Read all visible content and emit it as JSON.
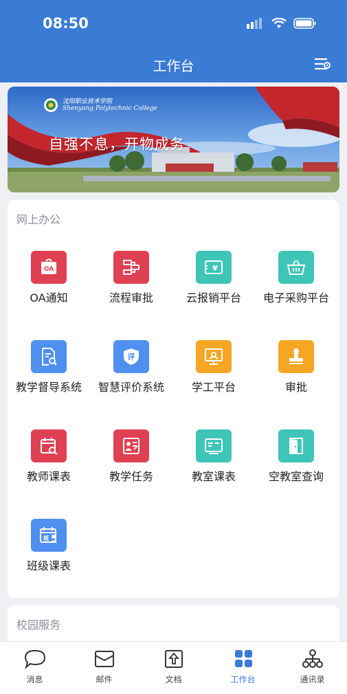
{
  "status_bar": {
    "time": "08:50"
  },
  "nav": {
    "title": "工作台",
    "settings_icon": "settings-sliders-icon"
  },
  "banner": {
    "college_name": "沈阳职业技术学院",
    "college_name_en": "Shenyang Polytechnic College",
    "slogan": "自强不息，开物成务"
  },
  "online_office": {
    "title": "网上办公",
    "items": [
      {
        "label": "OA通知",
        "icon": "oa-notice-icon",
        "color": "#e04152"
      },
      {
        "label": "流程审批",
        "icon": "workflow-approval-icon",
        "color": "#e04152"
      },
      {
        "label": "云报销平台",
        "icon": "reimbursement-icon",
        "color": "#3fc4b8"
      },
      {
        "label": "电子采购平台",
        "icon": "shopping-basket-icon",
        "color": "#3fc4b8"
      },
      {
        "label": "教学督导系统",
        "icon": "document-search-icon",
        "color": "#4f8ff0"
      },
      {
        "label": "智慧评价系统",
        "icon": "evaluation-shield-icon",
        "color": "#4f8ff0"
      },
      {
        "label": "学工平台",
        "icon": "presentation-screen-icon",
        "color": "#f5a623"
      },
      {
        "label": "审批",
        "icon": "stamp-icon",
        "color": "#f5a623"
      },
      {
        "label": "教师课表",
        "icon": "calendar-search-icon",
        "color": "#e04152"
      },
      {
        "label": "教学任务",
        "icon": "teaching-task-icon",
        "color": "#e04152"
      },
      {
        "label": "教室课表",
        "icon": "classroom-board-icon",
        "color": "#3fc4b8"
      },
      {
        "label": "空教室查询",
        "icon": "door-icon",
        "color": "#3fc4b8"
      },
      {
        "label": "班级课表",
        "icon": "class-schedule-icon",
        "color": "#4f8ff0"
      }
    ]
  },
  "campus_services": {
    "title": "校园服务"
  },
  "tabbar": {
    "active_color": "#3a7bd5",
    "tabs": [
      {
        "label": "消息",
        "icon": "message-bubble-icon"
      },
      {
        "label": "邮件",
        "icon": "mail-icon"
      },
      {
        "label": "文档",
        "icon": "document-icon"
      },
      {
        "label": "工作台",
        "icon": "grid-apps-icon",
        "active": true
      },
      {
        "label": "通讯录",
        "icon": "org-chart-icon"
      }
    ]
  }
}
